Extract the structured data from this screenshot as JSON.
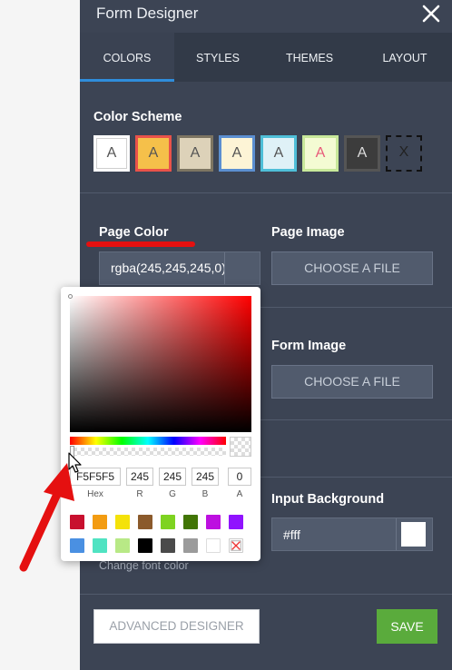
{
  "header": {
    "title": "Form Designer",
    "close_icon": "close-icon"
  },
  "tabs": [
    {
      "label": "COLORS",
      "active": true
    },
    {
      "label": "STYLES",
      "active": false
    },
    {
      "label": "THEMES",
      "active": false
    },
    {
      "label": "LAYOUT",
      "active": false
    }
  ],
  "color_scheme": {
    "label": "Color Scheme",
    "swatches": [
      {
        "letter": "A",
        "bg": "#ffffff",
        "border": "#ffffff",
        "text": "#555555"
      },
      {
        "letter": "A",
        "bg": "#f5c04a",
        "border": "#e9524a",
        "text": "#555555"
      },
      {
        "letter": "A",
        "bg": "#ddd2b9",
        "border": "#7d7562",
        "text": "#555555"
      },
      {
        "letter": "A",
        "bg": "#fdf4d6",
        "border": "#5b8fd1",
        "text": "#555555"
      },
      {
        "letter": "A",
        "bg": "#dff1f7",
        "border": "#4fbfd8",
        "text": "#555555"
      },
      {
        "letter": "A",
        "bg": "#f4fbd3",
        "border": "#c8e89a",
        "text": "#e85a7a"
      },
      {
        "letter": "A",
        "bg": "#3c3c3c",
        "border": "#555555",
        "text": "#dddddd"
      },
      {
        "letter": "X",
        "bg": "#3c4454",
        "border": "#111111",
        "text": "#222222"
      }
    ]
  },
  "page_color": {
    "label": "Page Color",
    "value": "rgba(245,245,245,0)"
  },
  "page_image": {
    "label": "Page Image",
    "button": "CHOOSE A FILE"
  },
  "form_image": {
    "label": "Form Image",
    "button": "CHOOSE A FILE"
  },
  "input_background": {
    "label": "Input Background",
    "value": "#fff",
    "swatch": "#ffffff"
  },
  "font_color_hint": "Change font color",
  "footer": {
    "advanced": "ADVANCED DESIGNER",
    "save": "SAVE"
  },
  "picker": {
    "hex": "F5F5F5",
    "r": "245",
    "g": "245",
    "b": "245",
    "a": "0",
    "labels": {
      "hex": "Hex",
      "r": "R",
      "g": "G",
      "b": "B",
      "a": "A"
    },
    "palette_row1": [
      "#c8102e",
      "#f39c12",
      "#f4e20a",
      "#8b5a2b",
      "#7ed321",
      "#417505",
      "#bd10e0",
      "#9013fe"
    ],
    "palette_row2": [
      "#4a90e2",
      "#50e3c2",
      "#b8e986",
      "#000000",
      "#4a4a4a",
      "#9b9b9b",
      "#ffffff",
      "none"
    ]
  },
  "colors": {
    "panel": "#3c4454",
    "tab_bar": "#323a48",
    "accent": "#2f8ddb",
    "save": "#5aab3c",
    "annotation": "#e51010"
  }
}
